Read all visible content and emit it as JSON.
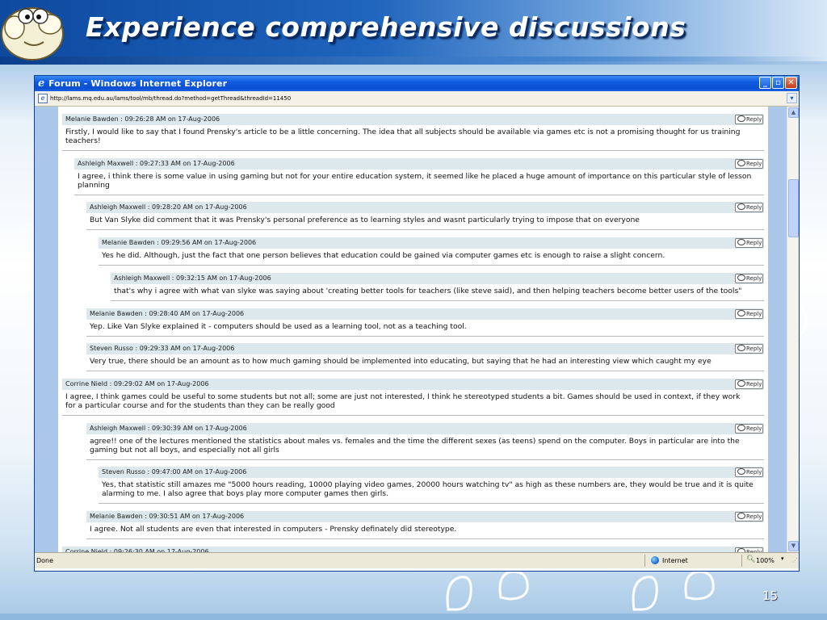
{
  "slide": {
    "title": "Experience comprehensive discussions",
    "page_number": "15"
  },
  "browser": {
    "window_title": "Forum - Windows Internet Explorer",
    "url": "http://lams.mq.edu.au/lams/tool/mb/thread.do?method=getThread&threadId=11450",
    "status_text": "Done",
    "zone_label": "Internet",
    "zoom_label": "100%"
  },
  "forum": {
    "reply_label": "Reply",
    "posts": [
      {
        "author": "Melanie Bawden : 09:26:28 AM on 17-Aug-2006",
        "lines": [
          "Firstly, I would like to say that I found Prensky's article to be a little concerning. The idea that all subjects should be available via games etc is not a promising thought for us training",
          "teachers!"
        ]
      },
      {
        "author": "Ashleigh Maxwell : 09:27:33 AM on 17-Aug-2006",
        "lines": [
          "I agree, i think there is some value in using gaming but not for your entire education system, it seemed like he placed a huge amount of importance on this particular style of lesson",
          "planning"
        ]
      },
      {
        "author": "Ashleigh Maxwell : 09:28:20 AM on 17-Aug-2006",
        "lines": [
          "But Van Slyke did comment that it was Prensky's personal preference as to learning styles and wasnt particularly trying to impose that on everyone"
        ]
      },
      {
        "author": "Melanie Bawden : 09:29:56 AM on 17-Aug-2006",
        "lines": [
          "Yes he did. Although, just the fact that one person believes that education could be gained via computer games etc is enough to raise a slight concern."
        ]
      },
      {
        "author": "Ashleigh Maxwell : 09:32:15 AM on 17-Aug-2006",
        "lines": [
          "that's why i agree with what van slyke was saying about 'creating better tools for teachers (like steve said), and then helping teachers become better users of the tools\""
        ]
      },
      {
        "author": "Melanie Bawden : 09:28:40 AM on 17-Aug-2006",
        "lines": [
          "Yep. Like Van Slyke explained it - computers should be used as a learning tool, not as a teaching tool."
        ]
      },
      {
        "author": "Steven Russo : 09:29:33 AM on 17-Aug-2006",
        "lines": [
          "Very true, there should be an amount as to how much gaming should be implemented into educating, but saying that he had an interesting view which caught my eye"
        ]
      },
      {
        "author": "Corrine Nield : 09:29:02 AM on 17-Aug-2006",
        "lines": [
          "I agree, I think games could be useful to some students but not all; some are just not interested, I think he stereotyped students a bit. Games should be used in context, if they work",
          "for a particular course and for the students than they can be really good"
        ]
      },
      {
        "author": "Ashleigh Maxwell : 09:30:39 AM on 17-Aug-2006",
        "lines": [
          "agree!! one of the lectures mentioned the statistics about males vs. females and the time the different sexes (as teens) spend on the computer. Boys in particular are into the",
          "gaming but not all boys, and especially not all girls"
        ]
      },
      {
        "author": "Steven Russo : 09:47:00 AM on 17-Aug-2006",
        "lines": [
          "Yes, that statistic still amazes me \"5000 hours reading, 10000 playing video games, 20000 hours watching tv\" as high as these numbers are, they would be true and it is quite",
          "alarming to me. I also agree that boys play more computer games then girls."
        ]
      },
      {
        "author": "Melanie Bawden : 09:30:51 AM on 17-Aug-2006",
        "lines": [
          "I agree. Not all students are even that interested in computers - Prensky definately did stereotype."
        ]
      },
      {
        "author": "Corrine Nield : 09:26:30 AM on 17-Aug-2006",
        "lines": []
      }
    ]
  }
}
